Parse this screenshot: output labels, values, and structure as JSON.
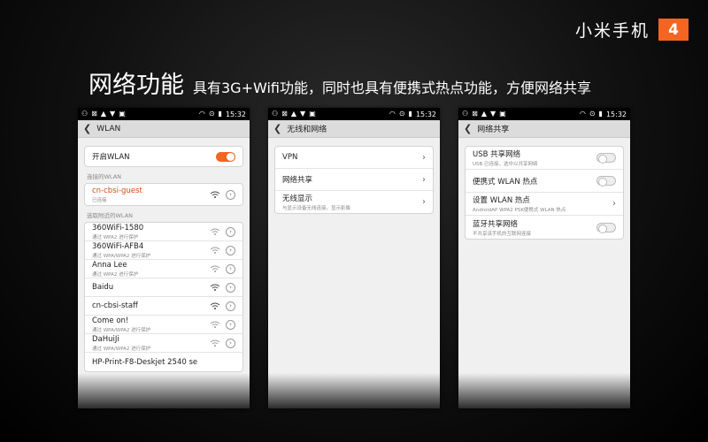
{
  "brand": {
    "text": "小米手机",
    "number": "4"
  },
  "heading": {
    "title": "网络功能",
    "subtitle": "具有3G+Wifi功能，同时也具有便携式热点功能，方便网络共享"
  },
  "statusbar": {
    "time": "15:32"
  },
  "screen1": {
    "title": "WLAN",
    "toggle_label": "开启WLAN",
    "connected_section": "连接的WLAN",
    "connected": {
      "name": "cn-cbsi-guest",
      "status": "已连接"
    },
    "available_section": "选取附近的WLAN",
    "networks": [
      {
        "name": "360WiFi-1580",
        "sub": "通过 WPA2 进行保护"
      },
      {
        "name": "360WiFi-AFB4",
        "sub": "通过 WPA/WPA2 进行保护"
      },
      {
        "name": "Anna Lee",
        "sub": "通过 WPA2 进行保护"
      },
      {
        "name": "Baidu",
        "sub": ""
      },
      {
        "name": "cn-cbsi-staff",
        "sub": ""
      },
      {
        "name": "Come on!",
        "sub": "通过 WPA/WPA2 进行保护"
      },
      {
        "name": "DaHuiJi",
        "sub": "通过 WPA/WPA2 进行保护"
      },
      {
        "name": "HP-Print-F8-Deskjet 2540 se",
        "sub": ""
      }
    ]
  },
  "screen2": {
    "title": "无线和网络",
    "items": [
      {
        "label": "VPN",
        "sub": ""
      },
      {
        "label": "网络共享",
        "sub": ""
      },
      {
        "label": "无线显示",
        "sub": "与显示设备无线连接，显示影像"
      }
    ]
  },
  "screen3": {
    "title": "网络共享",
    "items": [
      {
        "label": "USB 共享网络",
        "sub": "USB 已连接，选中以共享网络"
      },
      {
        "label": "便携式 WLAN 热点",
        "sub": ""
      },
      {
        "label": "设置 WLAN 热点",
        "sub": "AndroidAP WPA2 PSK便携式 WLAN 热点"
      },
      {
        "label": "蓝牙共享网络",
        "sub": "不共享该手机的互联网连接"
      }
    ]
  },
  "colors": {
    "accent": "#f26522",
    "connected_text": "#d24a1c"
  }
}
